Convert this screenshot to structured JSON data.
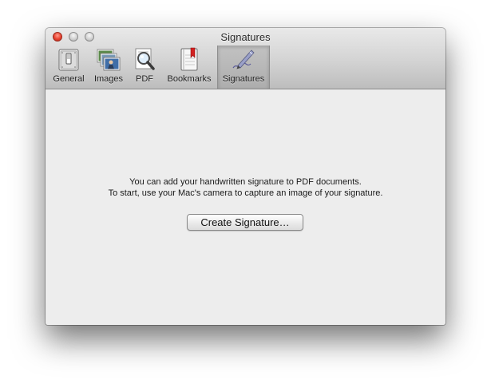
{
  "window": {
    "title": "Signatures"
  },
  "toolbar": {
    "tabs": [
      {
        "label": "General",
        "icon": "switch-icon"
      },
      {
        "label": "Images",
        "icon": "photos-icon"
      },
      {
        "label": "PDF",
        "icon": "magnifier-document-icon"
      },
      {
        "label": "Bookmarks",
        "icon": "bookmark-book-icon"
      },
      {
        "label": "Signatures",
        "icon": "pen-signature-icon"
      }
    ],
    "selected": "Signatures"
  },
  "content": {
    "line1": "You can add your handwritten signature to PDF documents.",
    "line2": "To start, use your Mac's camera to capture an image of your signature.",
    "button_label": "Create Signature…"
  },
  "colors": {
    "close": "#e8412f",
    "toolbar_top": "#e9e9e9",
    "toolbar_bottom": "#bdbdbd",
    "content_bg": "#ededed"
  }
}
